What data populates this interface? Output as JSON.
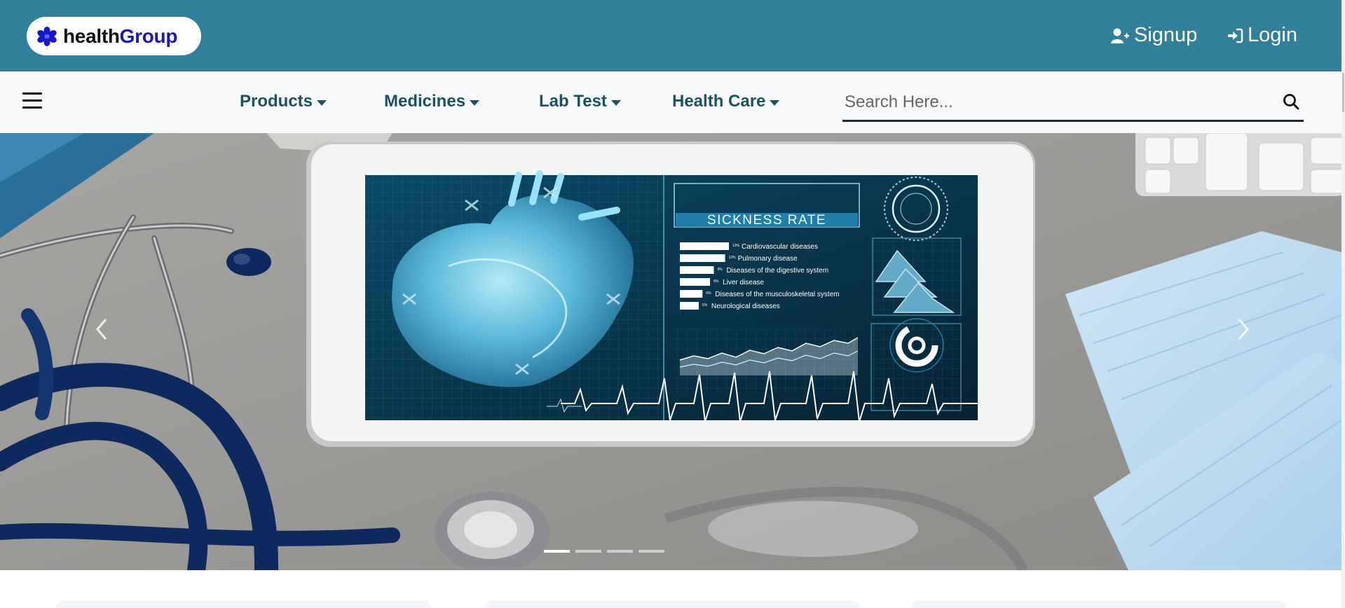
{
  "brand": {
    "name_part1": "health",
    "name_part2": "Group",
    "logo_icon": "flower-icon",
    "logo_color": "#1515d0"
  },
  "header": {
    "background": "#31809b",
    "signup": {
      "label": "Signup",
      "icon": "user-plus-icon"
    },
    "login": {
      "label": "Login",
      "icon": "sign-in-icon"
    }
  },
  "nav": {
    "menu_icon": "hamburger-icon",
    "items": [
      {
        "label": "Products"
      },
      {
        "label": "Medicines"
      },
      {
        "label": "Lab Test"
      },
      {
        "label": "Health Care"
      }
    ],
    "search": {
      "placeholder": "Search Here...",
      "value": "",
      "icon": "search-icon"
    }
  },
  "hero": {
    "screen_title": "SICKNESS RATE",
    "screen_rows": [
      {
        "pct": "13%",
        "label": "Cardiovascular diseases",
        "share": 0.13
      },
      {
        "pct": "12%",
        "label": "Pulmonary disease",
        "share": 0.12
      },
      {
        "pct": "9%",
        "label": "Diseases of the digestive system",
        "share": 0.09
      },
      {
        "pct": "8%",
        "label": "Liver disease",
        "share": 0.08
      },
      {
        "pct": "6%",
        "label": "Diseases of the musculoskeletal system",
        "share": 0.06
      },
      {
        "pct": "5%",
        "label": "Neurological diseases",
        "share": 0.05
      }
    ],
    "slides": 4,
    "active_slide": 1,
    "prev_icon": "chevron-left-icon",
    "next_icon": "chevron-right-icon"
  }
}
